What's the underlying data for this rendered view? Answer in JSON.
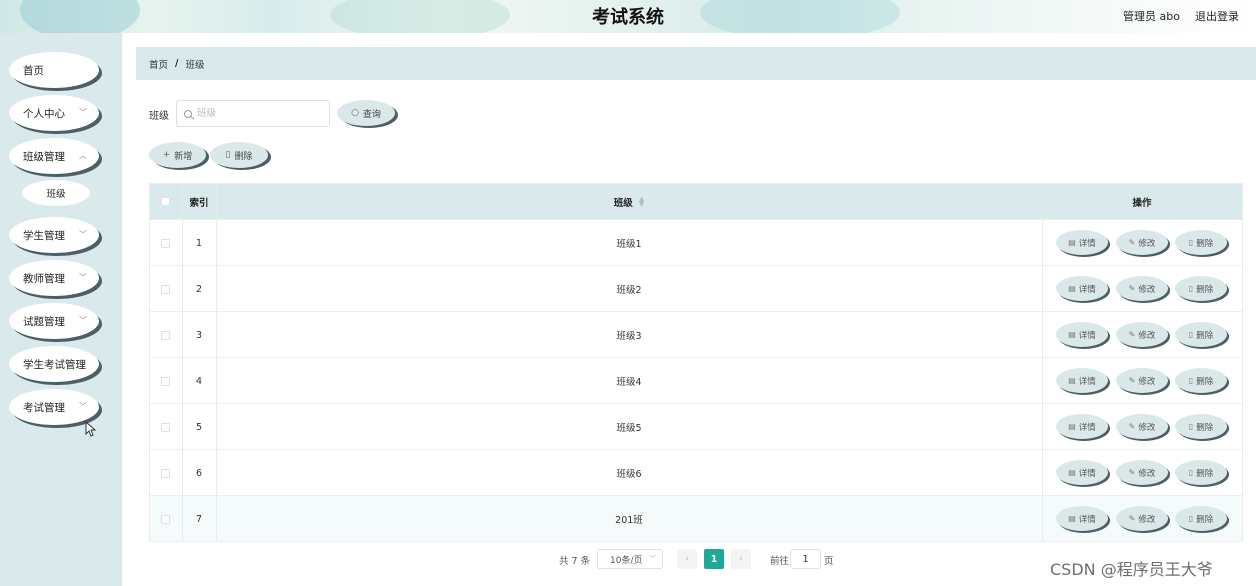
{
  "header": {
    "title": "考试系统",
    "user": "管理员 abo",
    "logout": "退出登录"
  },
  "sidebar": {
    "items": [
      {
        "label": "首页",
        "has_children": false
      },
      {
        "label": "个人中心",
        "has_children": true
      },
      {
        "label": "班级管理",
        "has_children": true,
        "expanded": true
      },
      {
        "label": "学生管理",
        "has_children": true
      },
      {
        "label": "教师管理",
        "has_children": true
      },
      {
        "label": "试题管理",
        "has_children": true
      },
      {
        "label": "学生考试管理",
        "has_children": false
      },
      {
        "label": "考试管理",
        "has_children": true
      }
    ],
    "submenu": {
      "label": "班级"
    }
  },
  "breadcrumb": {
    "home": "首页",
    "separator": "/",
    "current": "班级"
  },
  "search": {
    "label": "班级",
    "placeholder": "班级",
    "button": "查询"
  },
  "toolbar": {
    "add": "新增",
    "delete": "删除"
  },
  "table": {
    "headers": {
      "index": "索引",
      "class": "班级",
      "actions": "操作"
    },
    "rows": [
      {
        "index": "1",
        "class": "班级1"
      },
      {
        "index": "2",
        "class": "班级2"
      },
      {
        "index": "3",
        "class": "班级3"
      },
      {
        "index": "4",
        "class": "班级4"
      },
      {
        "index": "5",
        "class": "班级5"
      },
      {
        "index": "6",
        "class": "班级6"
      },
      {
        "index": "7",
        "class": "201班"
      }
    ],
    "actions": {
      "detail": "详情",
      "edit": "修改",
      "delete": "删除"
    }
  },
  "pagination": {
    "total": "共 7 条",
    "page_size": "10条/页",
    "prev": "‹",
    "current": "1",
    "next": "›",
    "goto_label": "前往",
    "goto_value": "1",
    "page_unit": "页"
  },
  "watermark": "CSDN @程序员王大爷",
  "colors": {
    "accent": "#1ea89a",
    "sidebar_bg": "#d9e9ec",
    "pill_bg": "#dbe8ea",
    "pill_shadow": "#4d5e66"
  },
  "icons": {
    "search": "search-icon",
    "add": "plus-icon",
    "delete": "trash-icon",
    "detail": "document-icon",
    "edit": "pencil-icon",
    "sort": "sort-icon",
    "chevron": "chevron-down-icon"
  }
}
